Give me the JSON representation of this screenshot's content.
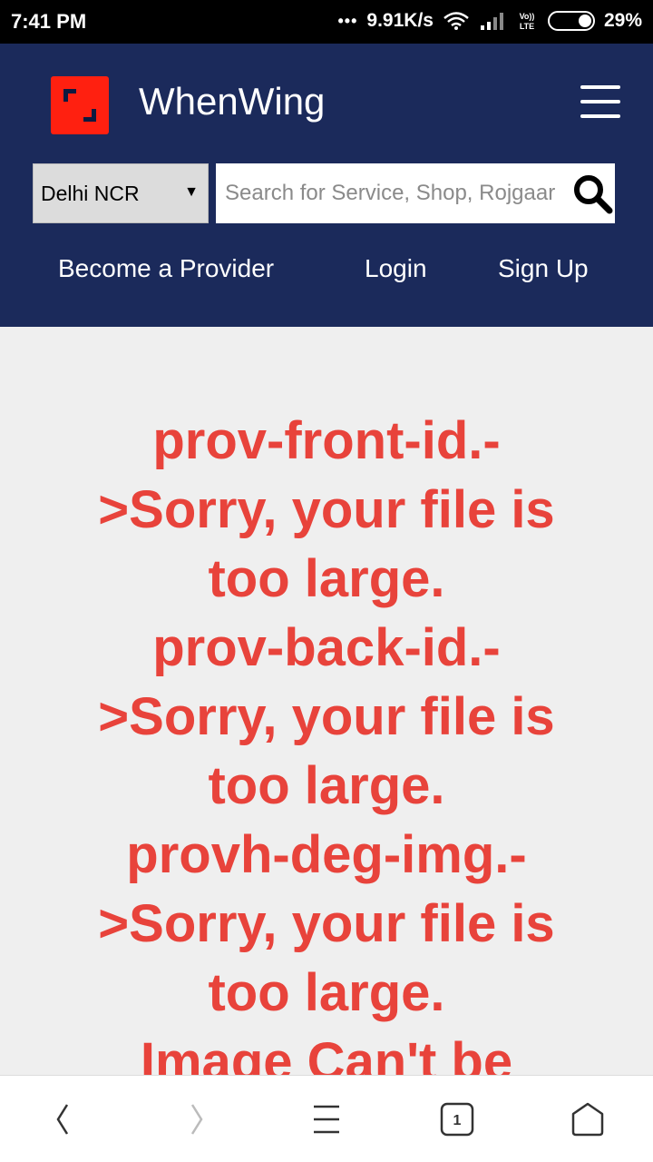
{
  "status_bar": {
    "time": "7:41 PM",
    "network_speed": "9.91K/s",
    "dots": "•••",
    "volte": "Vo)) LTE",
    "battery": "29%"
  },
  "header": {
    "brand": "WhenWing",
    "logo_color": "#ff2010",
    "background_color": "#1b2a5b",
    "city_select": {
      "selected": "Delhi NCR"
    },
    "search": {
      "placeholder": "Search for Service, Shop, Rojgaar"
    },
    "nav": {
      "become_provider": "Become a Provider",
      "login": "Login",
      "signup": "Sign Up"
    }
  },
  "main": {
    "error_color": "#e8433b",
    "messages": [
      "prov-front-id.->Sorry, your file is too large.",
      "prov-back-id.->Sorry, your file is too large.",
      "provh-deg-img.->Sorry, your file is too large.",
      "Image Can't be"
    ]
  },
  "bottom_bar": {
    "tab_count": "1",
    "icons": [
      "back-icon",
      "forward-icon",
      "menu-icon",
      "tabs-icon",
      "home-icon"
    ]
  }
}
